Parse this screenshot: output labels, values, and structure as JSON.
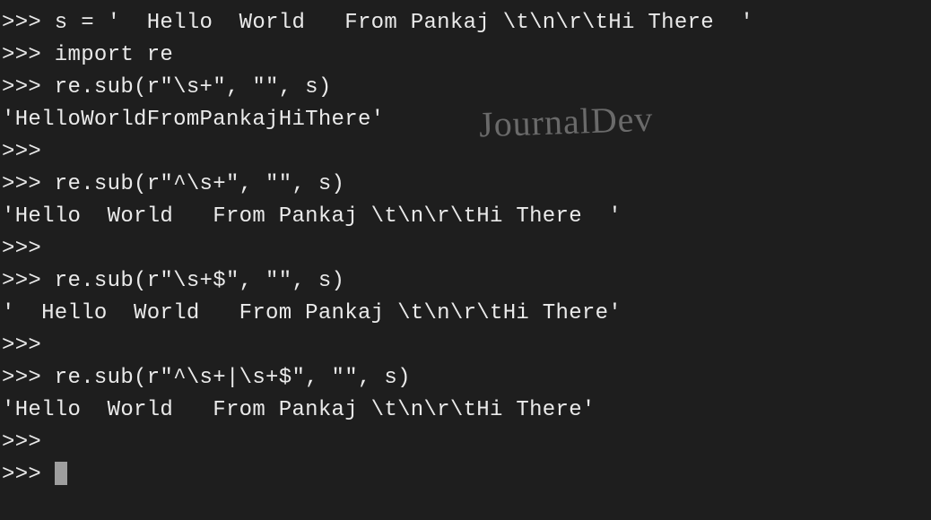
{
  "terminal": {
    "prompt": ">>> ",
    "lines": [
      {
        "type": "input",
        "text": "s = '  Hello  World   From Pankaj \\t\\n\\r\\tHi There  '"
      },
      {
        "type": "input",
        "text": "import re"
      },
      {
        "type": "input",
        "text": "re.sub(r\"\\s+\", \"\", s)"
      },
      {
        "type": "output",
        "text": "'HelloWorldFromPankajHiThere'"
      },
      {
        "type": "input",
        "text": ""
      },
      {
        "type": "input",
        "text": "re.sub(r\"^\\s+\", \"\", s)"
      },
      {
        "type": "output",
        "text": "'Hello  World   From Pankaj \\t\\n\\r\\tHi There  '"
      },
      {
        "type": "input",
        "text": ""
      },
      {
        "type": "input",
        "text": "re.sub(r\"\\s+$\", \"\", s)"
      },
      {
        "type": "output",
        "text": "'  Hello  World   From Pankaj \\t\\n\\r\\tHi There'"
      },
      {
        "type": "input",
        "text": ""
      },
      {
        "type": "input",
        "text": "re.sub(r\"^\\s+|\\s+$\", \"\", s)"
      },
      {
        "type": "output",
        "text": "'Hello  World   From Pankaj \\t\\n\\r\\tHi There'"
      },
      {
        "type": "input",
        "text": ""
      },
      {
        "type": "cursor",
        "text": ""
      }
    ]
  },
  "watermark": "JournalDev"
}
